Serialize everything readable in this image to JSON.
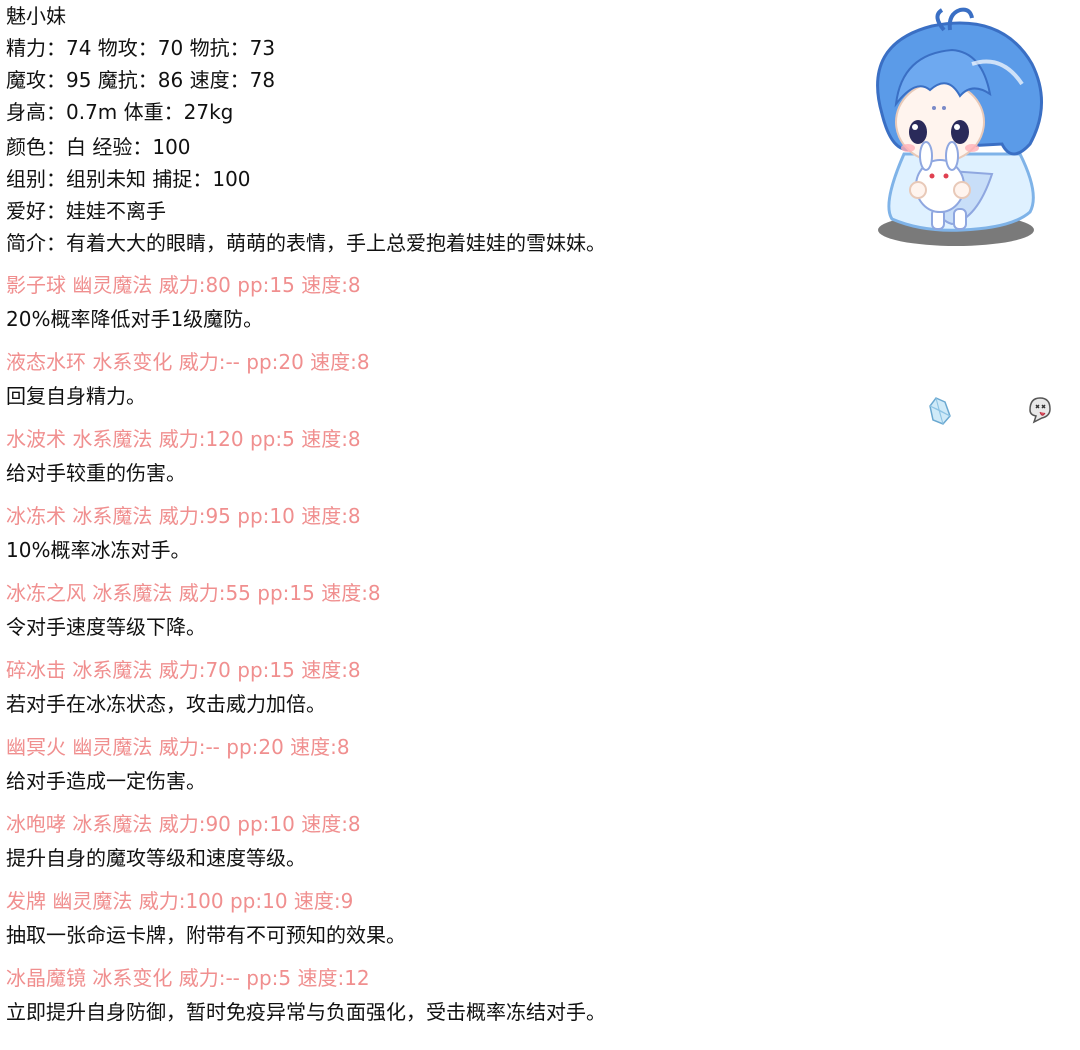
{
  "pet": {
    "name": "魅小妹",
    "stats_line1": "精力：74 物攻：70 物抗：73",
    "stats_line2": "魔攻：95 魔抗：86 速度：78",
    "stats_line3": "身高：0.7m 体重：27kg",
    "stats_line4": "颜色：白 经验：100",
    "stats_line5": "组别：组别未知 捕捉：100",
    "hobby": "爱好：娃娃不离手",
    "intro": "简介：有着大大的眼睛，萌萌的表情，手上总爱抱着娃娃的雪妹妹。"
  },
  "skills": [
    {
      "head": "影子球 幽灵魔法 威力:80 pp:15 速度:8",
      "desc": "20%概率降低对手1级魔防。"
    },
    {
      "head": "液态水环 水系变化 威力:-- pp:20 速度:8",
      "desc": "回复自身精力。"
    },
    {
      "head": "水波术 水系魔法 威力:120 pp:5 速度:8",
      "desc": "给对手较重的伤害。"
    },
    {
      "head": "冰冻术 冰系魔法 威力:95 pp:10 速度:8",
      "desc": "10%概率冰冻对手。"
    },
    {
      "head": "冰冻之风 冰系魔法 威力:55 pp:15 速度:8",
      "desc": "令对手速度等级下降。"
    },
    {
      "head": "碎冰击 冰系魔法 威力:70 pp:15 速度:8",
      "desc": "若对手在冰冻状态，攻击威力加倍。"
    },
    {
      "head": "幽冥火 幽灵魔法 威力:-- pp:20 速度:8",
      "desc": "给对手造成一定伤害。"
    },
    {
      "head": "冰咆哮 冰系魔法 威力:90 pp:10 速度:8",
      "desc": "提升自身的魔攻等级和速度等级。"
    },
    {
      "head": "发牌 幽灵魔法 威力:100 pp:10 速度:9",
      "desc": "抽取一张命运卡牌，附带有不可预知的效果。"
    },
    {
      "head": "冰晶魔镜 冰系变化 威力:-- pp:5 速度:12",
      "desc": "立即提升自身防御，暂时免疫异常与负面强化，受击概率冻结对手。"
    }
  ],
  "icons": {
    "portrait": "chibi-snow-girl-portrait",
    "element_1": "ice-crystal-icon",
    "element_2": "ghost-icon"
  },
  "colors": {
    "skill_head": "#f08f8f",
    "text": "#111111",
    "hair": "#5b9be8"
  }
}
